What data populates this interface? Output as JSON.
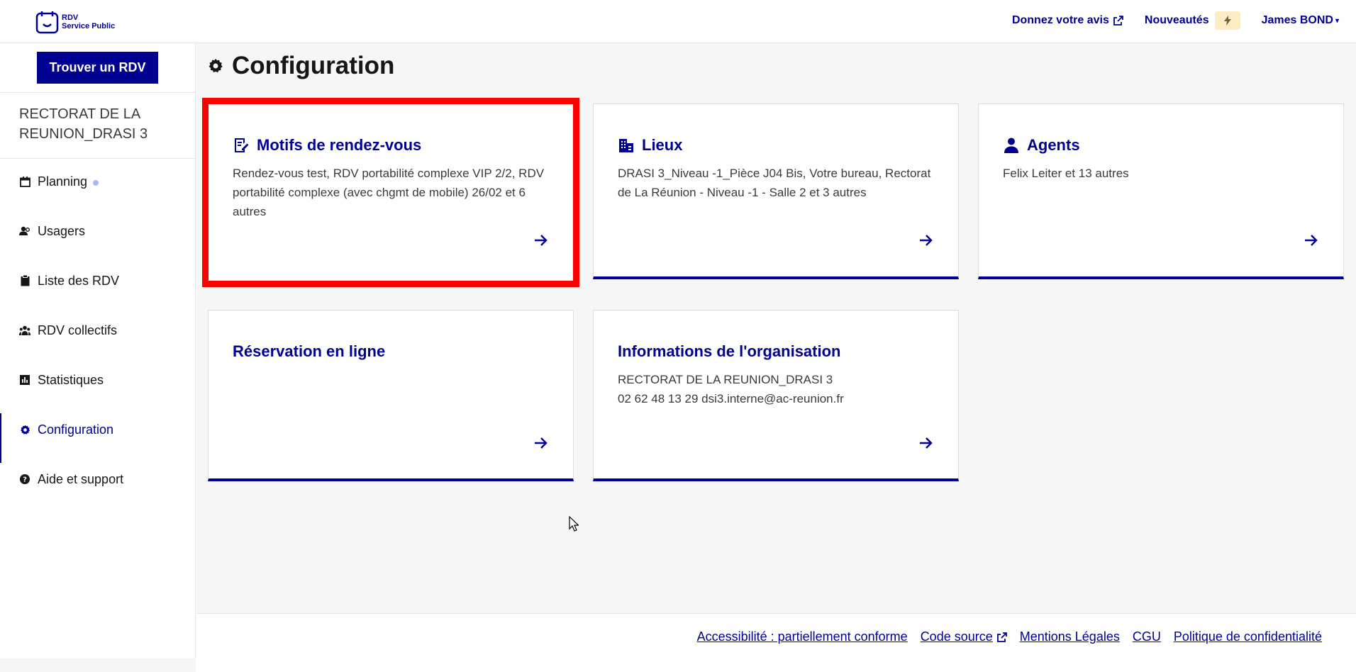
{
  "header": {
    "logo_line1": "RDV",
    "logo_line2": "Service Public",
    "feedback_link": "Donnez votre avis",
    "news_link": "Nouveautés",
    "user_menu": "James BOND"
  },
  "sidebar": {
    "find_button": "Trouver un RDV",
    "org_name": "RECTORAT DE LA REUNION_DRASI 3",
    "items": [
      {
        "label": "Planning",
        "icon": "calendar-icon"
      },
      {
        "label": "Usagers",
        "icon": "users-icon"
      },
      {
        "label": "Liste des RDV",
        "icon": "clipboard-icon"
      },
      {
        "label": "RDV collectifs",
        "icon": "group-icon"
      },
      {
        "label": "Statistiques",
        "icon": "bar-chart-icon"
      },
      {
        "label": "Configuration",
        "icon": "gear-icon"
      },
      {
        "label": "Aide et support",
        "icon": "question-icon"
      }
    ],
    "active_item": "Configuration",
    "active_color": "#000091"
  },
  "main": {
    "title": "Configuration",
    "cards": [
      {
        "title": "Motifs de rendez-vous",
        "icon": "edit-document-icon",
        "description": "Rendez-vous test, RDV portabilité complexe VIP 2/2, RDV portabilité complexe (avec chgmt de mobile) 26/02 et 6 autres"
      },
      {
        "title": "Lieux",
        "icon": "building-icon",
        "description": "DRASI 3_Niveau -1_Pièce J04 Bis, Votre bureau, Rectorat de La Réunion - Niveau -1 - Salle 2 et 3 autres"
      },
      {
        "title": "Agents",
        "icon": "person-icon",
        "description": "Felix Leiter et 13 autres"
      },
      {
        "title": "Réservation en ligne",
        "icon": "",
        "description": ""
      },
      {
        "title": "Informations de l'organisation",
        "icon": "",
        "description_line1": "RECTORAT DE LA REUNION_DRASI 3",
        "description_line2": "02 62 48 13 29 dsi3.interne@ac-reunion.fr"
      }
    ]
  },
  "footer": {
    "links": [
      "Accessibilité : partiellement conforme",
      "Code source",
      "Mentions Légales",
      "CGU",
      "Politique de confidentialité"
    ]
  },
  "colors": {
    "brand": "#000091",
    "highlight": "#ff0000",
    "badge_bg": "#feecc2"
  }
}
